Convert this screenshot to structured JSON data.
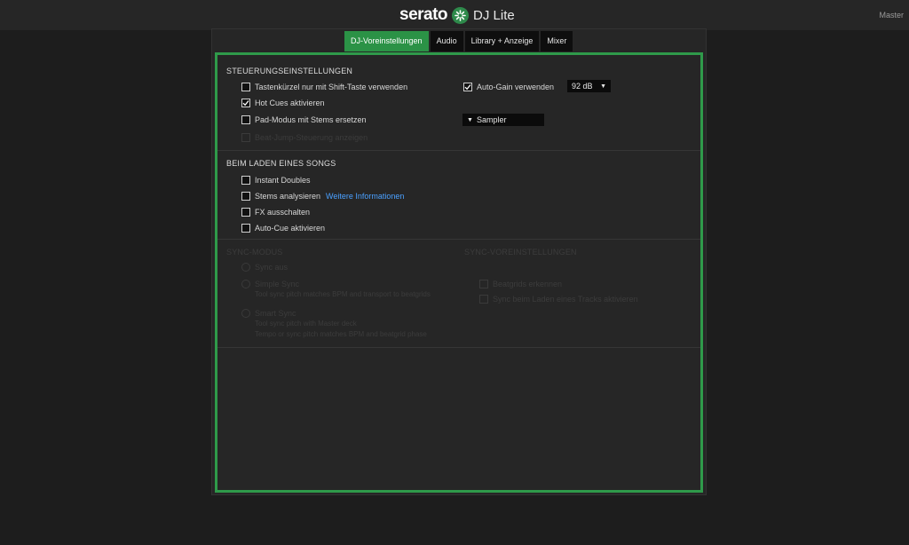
{
  "app": {
    "brand": "serato",
    "product": "DJ Lite",
    "master_label": "Master"
  },
  "tabs": [
    {
      "label": "DJ-Voreinstellungen"
    },
    {
      "label": "Audio"
    },
    {
      "label": "Library + Anzeige"
    },
    {
      "label": "Mixer"
    }
  ],
  "steuerung": {
    "title": "STEUERUNGSEINSTELLUNGEN",
    "shift": {
      "label": "Tastenkürzel nur mit Shift-Taste verwenden",
      "checked": false
    },
    "hotcues": {
      "label": "Hot Cues aktivieren",
      "checked": true
    },
    "pad": {
      "label": "Pad-Modus mit Stems ersetzen",
      "checked": false
    },
    "disabled_option": {
      "label": "Beat-Jump-Steuerung anzeigen",
      "checked": false
    },
    "autogain": {
      "label": "Auto-Gain verwenden",
      "checked": true,
      "value": "92 dB"
    },
    "pad_select": {
      "value": "Sampler"
    }
  },
  "laden": {
    "title": "BEIM LADEN EINES SONGS",
    "instant": {
      "label": "Instant Doubles",
      "checked": false
    },
    "stems": {
      "label": "Stems analysieren",
      "checked": false,
      "link": "Weitere Informationen"
    },
    "fx": {
      "label": "FX ausschalten",
      "checked": false
    },
    "autocue": {
      "label": "Auto-Cue aktivieren",
      "checked": false
    }
  },
  "sync": {
    "title": "SYNC-MODUS",
    "off": "Sync aus",
    "simple": "Simple Sync",
    "simple_desc": "Tool sync pitch matches BPM and transport to beatgrids",
    "smart": "Smart Sync",
    "smart_desc1": "Tool sync pitch with Master deck",
    "smart_desc2": "Tempo or sync pitch matches BPM and beatgrid phase",
    "prefs_title": "SYNC-VOREINSTELLUNGEN",
    "pref1": "Beatgrids erkennen",
    "pref2": "Sync beim Laden eines Tracks aktivieren"
  },
  "colors": {
    "accent": "#2f9a4a",
    "link": "#4aa0ff"
  }
}
